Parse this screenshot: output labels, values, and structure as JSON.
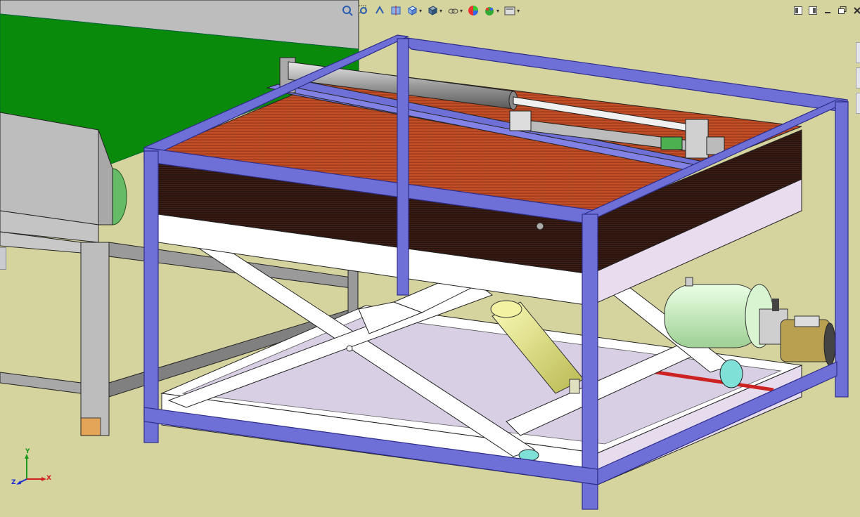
{
  "window": {
    "title": "",
    "controls": [
      "tile-left-icon",
      "tile-right-icon",
      "minimize-icon",
      "restore-icon",
      "close-icon"
    ]
  },
  "heads_up_toolbar": {
    "tools": [
      {
        "name": "zoom-to-fit-icon"
      },
      {
        "name": "zoom-to-area-icon"
      },
      {
        "name": "previous-view-icon"
      },
      {
        "name": "section-view-icon"
      },
      {
        "name": "view-orientation-icon",
        "dropdown": true
      },
      {
        "name": "display-style-icon",
        "dropdown": true
      },
      {
        "name": "hide-show-items-icon",
        "dropdown": true
      },
      {
        "name": "edit-appearance-icon"
      },
      {
        "name": "apply-scene-icon",
        "dropdown": true
      },
      {
        "name": "view-settings-icon",
        "dropdown": true
      }
    ]
  },
  "triad": {
    "x_label": "X",
    "y_label": "Y",
    "z_label": "Z"
  },
  "colors": {
    "background": "#d6d49e",
    "frame": "#6f6fd8",
    "frame_dark": "#2e2e8a",
    "wood": "#b84a22",
    "belt": "#0a8a0a",
    "scissor": "#ffffff",
    "cylinder": "#e0e07a",
    "motor": "#cdf0c4"
  }
}
